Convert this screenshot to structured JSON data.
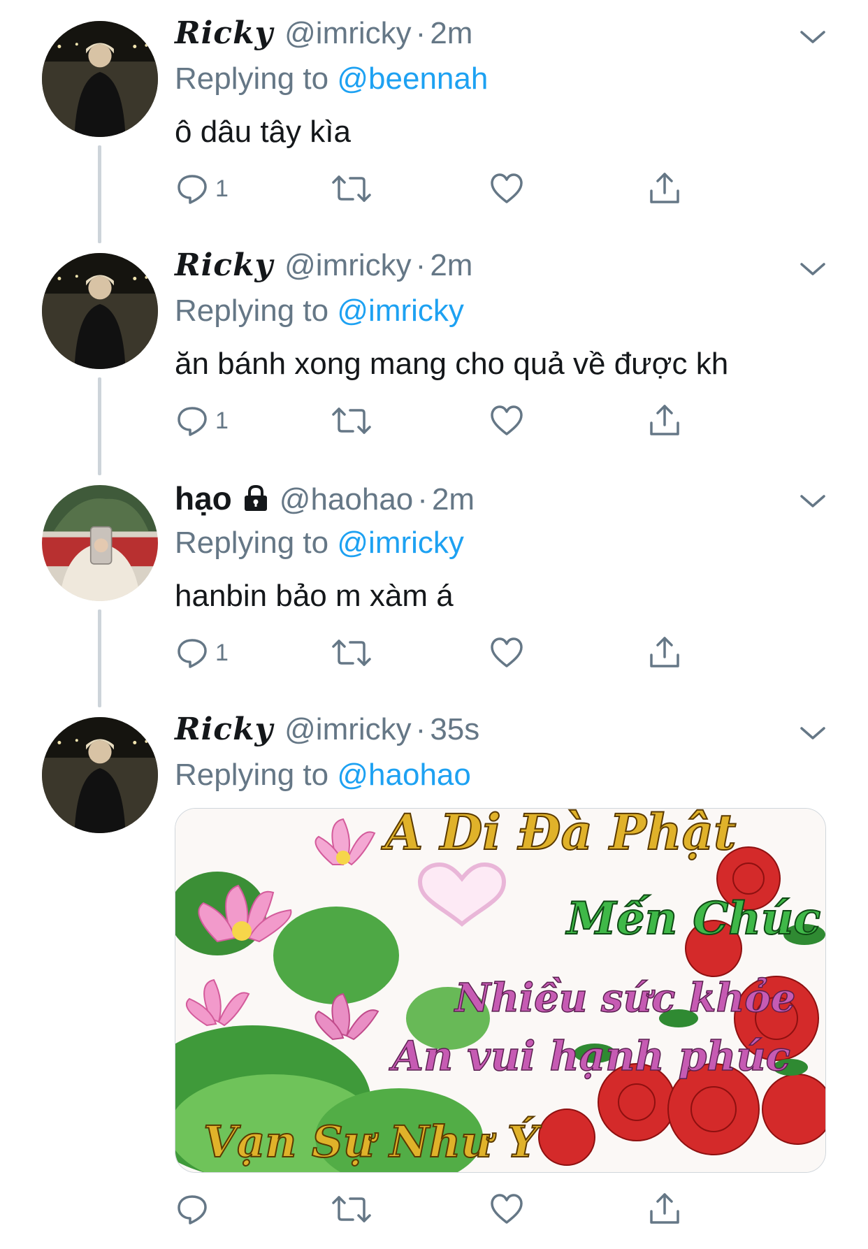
{
  "tweets": [
    {
      "name": "Ricky",
      "handle": "@imricky",
      "dot": "·",
      "time": "2m",
      "replying_prefix": "Replying to",
      "replying_to": "@beennah",
      "text": "ô dâu tây kìa",
      "reply_count": "1"
    },
    {
      "name": "Ricky",
      "handle": "@imricky",
      "dot": "·",
      "time": "2m",
      "replying_prefix": "Replying to",
      "replying_to": "@imricky",
      "text": "ăn bánh xong mang cho quả về được kh",
      "reply_count": "1"
    },
    {
      "name": "hạo",
      "handle": "@haohao",
      "dot": "·",
      "time": "2m",
      "replying_prefix": "Replying to",
      "replying_to": "@imricky",
      "text": "hanbin bảo m xàm á",
      "reply_count": "1"
    },
    {
      "name": "Ricky",
      "handle": "@imricky",
      "dot": "·",
      "time": "35s",
      "replying_prefix": "Replying to",
      "replying_to": "@haohao",
      "reply_count": "",
      "image": {
        "line1": "A Di Đà Phật",
        "line2": "Mến Chúc",
        "line3": "Nhiều sức khỏe",
        "line4": "An vui hạnh phúc",
        "line5": "Vạn Sự Như Ý"
      }
    }
  ],
  "colors": {
    "link": "#1da1f2",
    "secondary": "#657786",
    "thread_line": "#cdd4da"
  },
  "icons": [
    "reply-icon",
    "retweet-icon",
    "like-icon",
    "share-icon",
    "chevron-down-icon",
    "lock-icon"
  ]
}
